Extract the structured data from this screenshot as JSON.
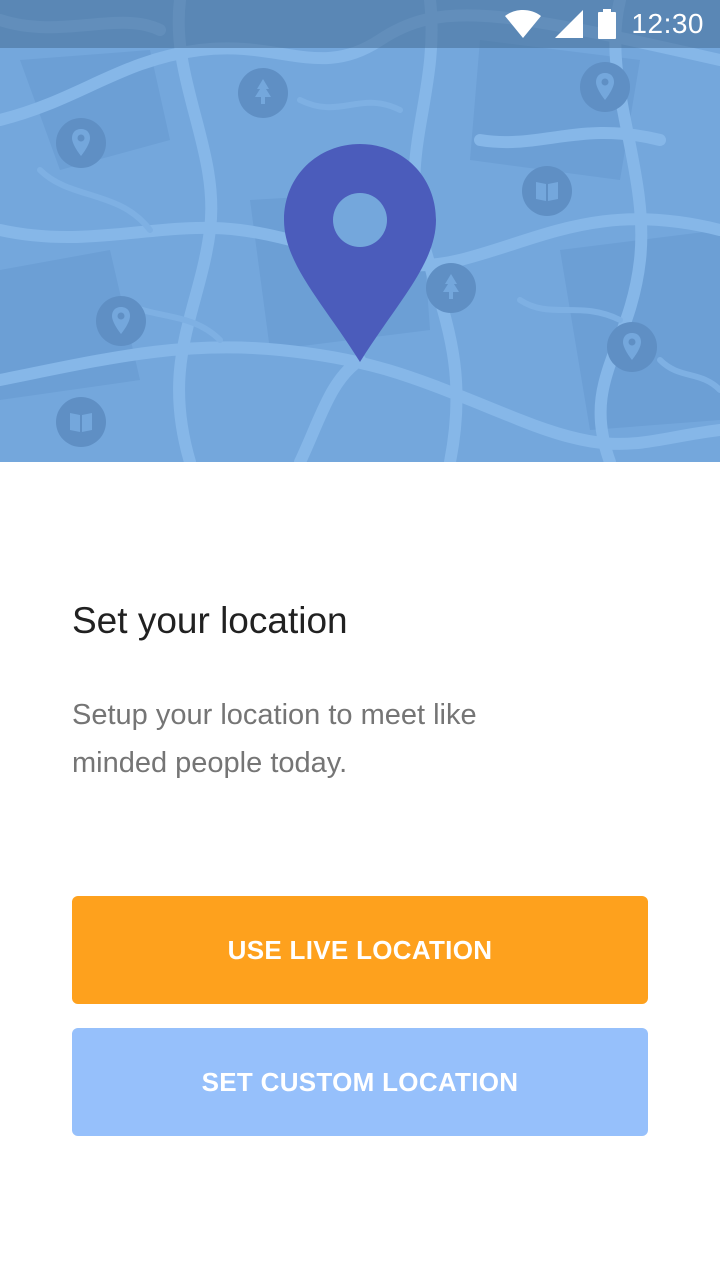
{
  "status_bar": {
    "time": "12:30",
    "icons": [
      "wifi-icon",
      "signal-icon",
      "battery-icon"
    ]
  },
  "hero": {
    "map_colors": {
      "background": "#74a7dc",
      "roads": "#86b7e8",
      "blocks": "#6a9dd3",
      "marker": "#4b5cbb",
      "poi_badge": "#5f8fc4"
    },
    "poi_icons": [
      "location-pin-icon",
      "tree-icon",
      "book-icon"
    ]
  },
  "content": {
    "title": "Set your location",
    "subtitle": "Setup your location to meet like minded people today.",
    "primary_button": "USE LIVE LOCATION",
    "secondary_button": "SET CUSTOM LOCATION"
  },
  "colors": {
    "primary_button_bg": "#fea11d",
    "secondary_button_bg": "#96c0fb",
    "title_text": "#212121",
    "subtitle_text": "#757575"
  }
}
